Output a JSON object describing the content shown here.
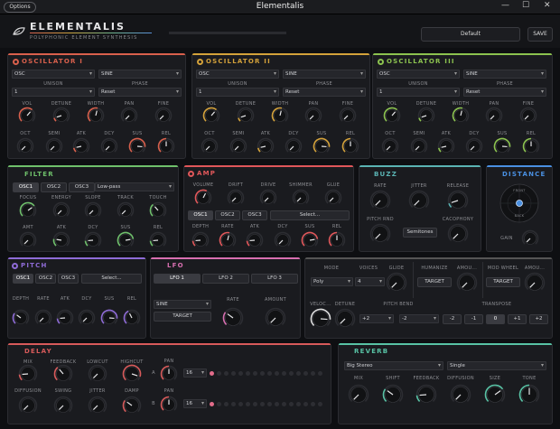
{
  "window": {
    "options": "Options",
    "title": "Elementalis",
    "minimize": "—",
    "maximize": "☐",
    "close": "✕"
  },
  "header": {
    "brand": "ELEMENTALIS",
    "tagline": "POLYPHONIC ELEMENT SYNTHESIS",
    "preset": "Default",
    "save": "SAVE"
  },
  "colors": {
    "osc1": "#d9604c",
    "osc2": "#d4a23a",
    "osc3": "#8cc34f",
    "filter": "#6fc06b",
    "amp": "#e0575a",
    "buzz": "#5ab3b3",
    "distance": "#4a90e2",
    "pitch": "#8e6bd6",
    "lfo": "#d76fb0",
    "delay": "#d85a5a",
    "reverb": "#58c3a5"
  },
  "osc": [
    {
      "title": "OSCILLATOR I",
      "type": "OSC",
      "wave": "SINE",
      "unison_label": "UNISON",
      "phase_label": "PHASE",
      "unison": "1",
      "phase": "Reset",
      "row1": [
        "VOL",
        "DETUNE",
        "WIDTH",
        "PAN",
        "FINE"
      ],
      "row2": [
        "OCT",
        "SEMI",
        "ATK",
        "DCY",
        "SUS",
        "REL"
      ]
    },
    {
      "title": "OSCILLATOR II",
      "type": "OSC",
      "wave": "SINE",
      "unison_label": "UNISON",
      "phase_label": "PHASE",
      "unison": "1",
      "phase": "Reset",
      "row1": [
        "VOL",
        "DETUNE",
        "WIDTH",
        "PAN",
        "FINE"
      ],
      "row2": [
        "OCT",
        "SEMI",
        "ATK",
        "DCY",
        "SUS",
        "REL"
      ]
    },
    {
      "title": "OSCILLATOR III",
      "type": "OSC",
      "wave": "SINE",
      "unison_label": "UNISON",
      "phase_label": "PHASE",
      "unison": "1",
      "phase": "Reset",
      "row1": [
        "VOL",
        "DETUNE",
        "WIDTH",
        "PAN",
        "FINE"
      ],
      "row2": [
        "OCT",
        "SEMI",
        "ATK",
        "DCY",
        "SUS",
        "REL"
      ]
    }
  ],
  "filter": {
    "title": "FILTER",
    "tabs": [
      "OSC1",
      "OSC2",
      "OSC3"
    ],
    "mode": "Low-pass",
    "row1": [
      "FOCUS",
      "ENERGY",
      "SLOPE",
      "TRACK",
      "TOUCH"
    ],
    "row2": [
      "AMT",
      "ATK",
      "DCY",
      "SUS",
      "REL"
    ]
  },
  "amp": {
    "title": "AMP",
    "row1": [
      "VOLUME",
      "DRIFT",
      "DRIVE",
      "SHIMMER",
      "GLUE"
    ],
    "tabs": [
      "OSC1",
      "OSC2",
      "OSC3"
    ],
    "select": "Select...",
    "row2": [
      "DEPTH",
      "RATE",
      "ATK",
      "DCY",
      "SUS",
      "REL"
    ]
  },
  "buzz": {
    "title": "BUZZ",
    "rate": "RATE",
    "jitter": "JITTER",
    "release": "RELEASE",
    "pitch_rnd": "PITCH RND",
    "semitones": "Semitones",
    "cacophony": "CACOPHONY"
  },
  "distance": {
    "title": "DISTANCE",
    "front": "FRONT",
    "back": "BACK",
    "gain": "GAIN"
  },
  "pitch": {
    "title": "PITCH",
    "tabs": [
      "OSC1",
      "OSC2",
      "OSC3"
    ],
    "select": "Select...",
    "knobs": [
      "DEPTH",
      "RATE",
      "ATK",
      "DCY",
      "SUS",
      "REL"
    ]
  },
  "lfo": {
    "title": "LFO",
    "tabs": [
      "LFO 1",
      "LFO 2",
      "LFO 3"
    ],
    "wave": "SINE",
    "target": "TARGET",
    "rate": "RATE",
    "amount": "AMOUNT"
  },
  "voice": {
    "mode_label": "MODE",
    "mode": "Poly",
    "voices_label": "VOICES",
    "voices": "4",
    "glide": "GLIDE",
    "humanize": "HUMANIZE",
    "amount": "AMOU...",
    "target": "TARGET",
    "modwheel": "MOD WHEEL",
    "amount2": "AMOU...",
    "target2": "TARGET",
    "velocity": "VELOC...",
    "detune": "DETUNE",
    "pitchbend": "PITCH BEND",
    "pb_up": "+2",
    "pb_down": "-2",
    "transpose": "TRANSPOSE",
    "transpose_btns": [
      "-2",
      "-1",
      "0",
      "+1",
      "+2"
    ]
  },
  "delay": {
    "title": "DELAY",
    "row1": [
      "MIX",
      "FEEDBACK",
      "LOWCUT",
      "HIGHCUT"
    ],
    "pan": "PAN",
    "row2": [
      "DIFFUSION",
      "SWING",
      "JITTER",
      "DAMP"
    ],
    "pan2": "PAN",
    "a": "A",
    "b": "B",
    "steps_a": "16",
    "steps_b": "16"
  },
  "reverb": {
    "title": "REVERB",
    "type": "Big Stereo",
    "mode": "Single",
    "knobs": [
      "MIX",
      "SHIFT",
      "FEEDBACK",
      "DIFFUSION",
      "SIZE",
      "TONE"
    ]
  }
}
